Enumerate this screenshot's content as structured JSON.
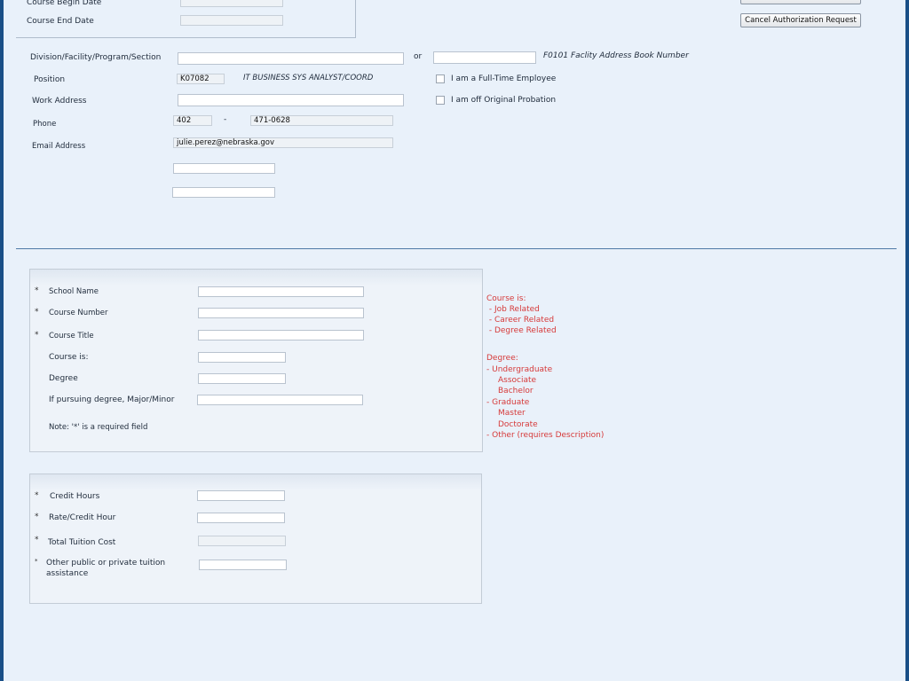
{
  "top_box": {
    "course_begin_label": "Course Begin Date",
    "course_end_label": "Course End Date"
  },
  "buttons": {
    "cancel_label": "Cancel Authorization Request"
  },
  "employee": {
    "division_label": "Division/Facility/Program/Section",
    "or_label": "or",
    "address_book_label": "F0101 Faclity Address Book Number",
    "position_label": "Position",
    "position_code": "K07082",
    "position_title": "IT BUSINESS SYS ANALYST/COORD",
    "fulltime_label": "I am a Full-Time Employee",
    "work_address_label": "Work Address",
    "probation_label": "I am off Original Probation",
    "phone_label": "Phone",
    "phone_area": "402",
    "phone_dash": "-",
    "phone_number": "471-0628",
    "email_label": "Email Address",
    "email_value": "julie.perez@nebraska.gov"
  },
  "course_section": {
    "required_mark": "*",
    "school_name_label": "School Name",
    "course_number_label": "Course Number",
    "course_title_label": "Course Title",
    "course_is_label": "Course is:",
    "degree_label": "Degree",
    "major_label": "If pursuing degree, Major/Minor",
    "note": "Note: '*' is a required field"
  },
  "help_text": {
    "course_is_heading": "Course is:",
    "course_is_options": [
      " - Job Related",
      " - Career Related",
      " - Degree Related"
    ],
    "degree_heading": "Degree:",
    "degree_lines": [
      "- Undergraduate",
      "Associate",
      "Bachelor",
      "- Graduate",
      "Master",
      "Doctorate",
      "- Other (requires Description)"
    ]
  },
  "tuition_section": {
    "credit_hours_label": "Credit Hours",
    "rate_label": "Rate/Credit Hour",
    "total_label": "Total Tuition Cost",
    "other_assist_label_1": "Other public or private tuition",
    "other_assist_label_2": "assistance"
  }
}
